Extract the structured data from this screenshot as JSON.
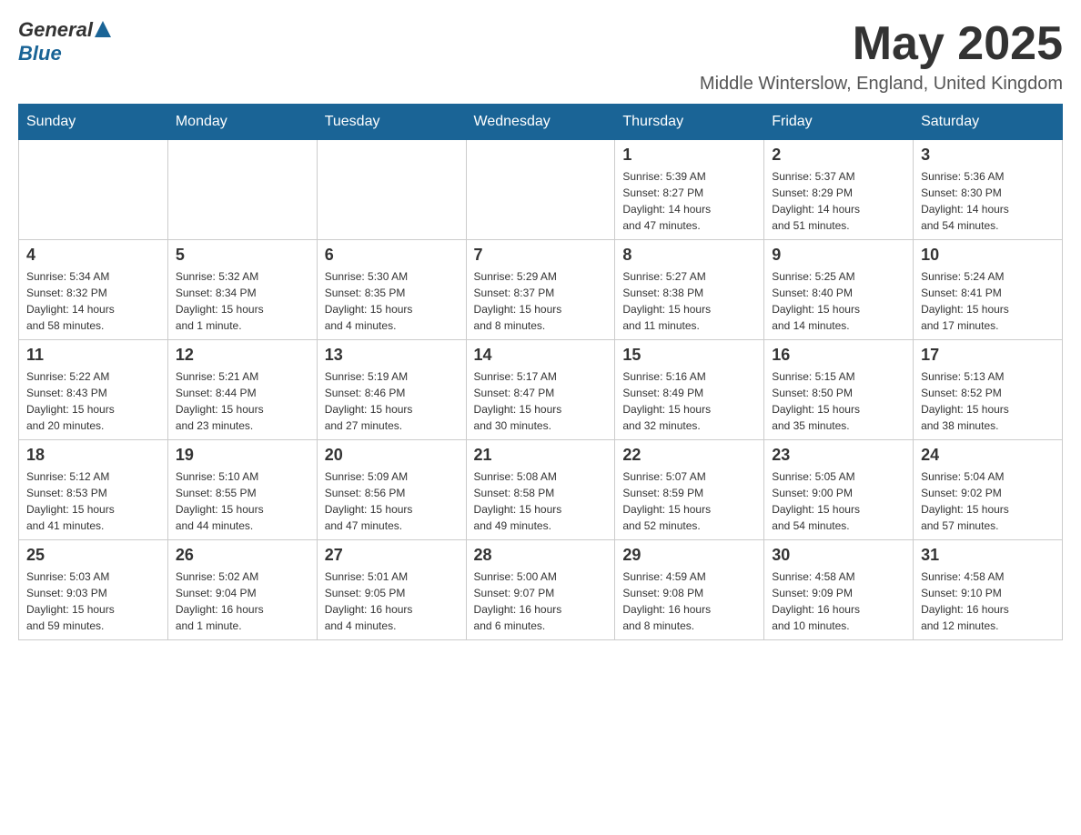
{
  "header": {
    "logo_general": "General",
    "logo_blue": "Blue",
    "month_title": "May 2025",
    "subtitle": "Middle Winterslow, England, United Kingdom"
  },
  "days_of_week": [
    "Sunday",
    "Monday",
    "Tuesday",
    "Wednesday",
    "Thursday",
    "Friday",
    "Saturday"
  ],
  "weeks": [
    [
      {
        "day": "",
        "info": ""
      },
      {
        "day": "",
        "info": ""
      },
      {
        "day": "",
        "info": ""
      },
      {
        "day": "",
        "info": ""
      },
      {
        "day": "1",
        "info": "Sunrise: 5:39 AM\nSunset: 8:27 PM\nDaylight: 14 hours\nand 47 minutes."
      },
      {
        "day": "2",
        "info": "Sunrise: 5:37 AM\nSunset: 8:29 PM\nDaylight: 14 hours\nand 51 minutes."
      },
      {
        "day": "3",
        "info": "Sunrise: 5:36 AM\nSunset: 8:30 PM\nDaylight: 14 hours\nand 54 minutes."
      }
    ],
    [
      {
        "day": "4",
        "info": "Sunrise: 5:34 AM\nSunset: 8:32 PM\nDaylight: 14 hours\nand 58 minutes."
      },
      {
        "day": "5",
        "info": "Sunrise: 5:32 AM\nSunset: 8:34 PM\nDaylight: 15 hours\nand 1 minute."
      },
      {
        "day": "6",
        "info": "Sunrise: 5:30 AM\nSunset: 8:35 PM\nDaylight: 15 hours\nand 4 minutes."
      },
      {
        "day": "7",
        "info": "Sunrise: 5:29 AM\nSunset: 8:37 PM\nDaylight: 15 hours\nand 8 minutes."
      },
      {
        "day": "8",
        "info": "Sunrise: 5:27 AM\nSunset: 8:38 PM\nDaylight: 15 hours\nand 11 minutes."
      },
      {
        "day": "9",
        "info": "Sunrise: 5:25 AM\nSunset: 8:40 PM\nDaylight: 15 hours\nand 14 minutes."
      },
      {
        "day": "10",
        "info": "Sunrise: 5:24 AM\nSunset: 8:41 PM\nDaylight: 15 hours\nand 17 minutes."
      }
    ],
    [
      {
        "day": "11",
        "info": "Sunrise: 5:22 AM\nSunset: 8:43 PM\nDaylight: 15 hours\nand 20 minutes."
      },
      {
        "day": "12",
        "info": "Sunrise: 5:21 AM\nSunset: 8:44 PM\nDaylight: 15 hours\nand 23 minutes."
      },
      {
        "day": "13",
        "info": "Sunrise: 5:19 AM\nSunset: 8:46 PM\nDaylight: 15 hours\nand 27 minutes."
      },
      {
        "day": "14",
        "info": "Sunrise: 5:17 AM\nSunset: 8:47 PM\nDaylight: 15 hours\nand 30 minutes."
      },
      {
        "day": "15",
        "info": "Sunrise: 5:16 AM\nSunset: 8:49 PM\nDaylight: 15 hours\nand 32 minutes."
      },
      {
        "day": "16",
        "info": "Sunrise: 5:15 AM\nSunset: 8:50 PM\nDaylight: 15 hours\nand 35 minutes."
      },
      {
        "day": "17",
        "info": "Sunrise: 5:13 AM\nSunset: 8:52 PM\nDaylight: 15 hours\nand 38 minutes."
      }
    ],
    [
      {
        "day": "18",
        "info": "Sunrise: 5:12 AM\nSunset: 8:53 PM\nDaylight: 15 hours\nand 41 minutes."
      },
      {
        "day": "19",
        "info": "Sunrise: 5:10 AM\nSunset: 8:55 PM\nDaylight: 15 hours\nand 44 minutes."
      },
      {
        "day": "20",
        "info": "Sunrise: 5:09 AM\nSunset: 8:56 PM\nDaylight: 15 hours\nand 47 minutes."
      },
      {
        "day": "21",
        "info": "Sunrise: 5:08 AM\nSunset: 8:58 PM\nDaylight: 15 hours\nand 49 minutes."
      },
      {
        "day": "22",
        "info": "Sunrise: 5:07 AM\nSunset: 8:59 PM\nDaylight: 15 hours\nand 52 minutes."
      },
      {
        "day": "23",
        "info": "Sunrise: 5:05 AM\nSunset: 9:00 PM\nDaylight: 15 hours\nand 54 minutes."
      },
      {
        "day": "24",
        "info": "Sunrise: 5:04 AM\nSunset: 9:02 PM\nDaylight: 15 hours\nand 57 minutes."
      }
    ],
    [
      {
        "day": "25",
        "info": "Sunrise: 5:03 AM\nSunset: 9:03 PM\nDaylight: 15 hours\nand 59 minutes."
      },
      {
        "day": "26",
        "info": "Sunrise: 5:02 AM\nSunset: 9:04 PM\nDaylight: 16 hours\nand 1 minute."
      },
      {
        "day": "27",
        "info": "Sunrise: 5:01 AM\nSunset: 9:05 PM\nDaylight: 16 hours\nand 4 minutes."
      },
      {
        "day": "28",
        "info": "Sunrise: 5:00 AM\nSunset: 9:07 PM\nDaylight: 16 hours\nand 6 minutes."
      },
      {
        "day": "29",
        "info": "Sunrise: 4:59 AM\nSunset: 9:08 PM\nDaylight: 16 hours\nand 8 minutes."
      },
      {
        "day": "30",
        "info": "Sunrise: 4:58 AM\nSunset: 9:09 PM\nDaylight: 16 hours\nand 10 minutes."
      },
      {
        "day": "31",
        "info": "Sunrise: 4:58 AM\nSunset: 9:10 PM\nDaylight: 16 hours\nand 12 minutes."
      }
    ]
  ]
}
